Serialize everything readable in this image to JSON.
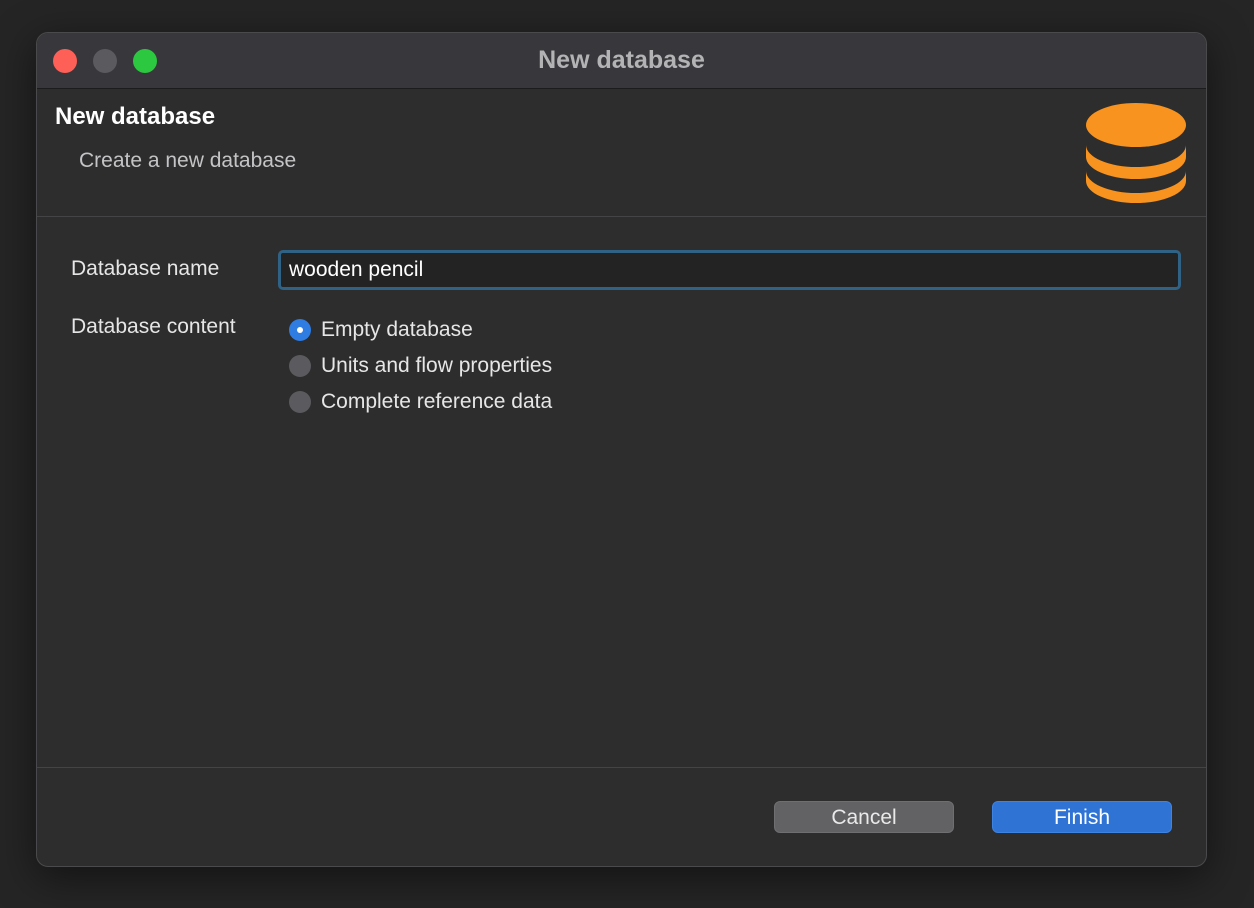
{
  "window": {
    "title": "New database"
  },
  "header": {
    "title": "New database",
    "subtitle": "Create a new database",
    "icon": "database-icon",
    "icon_color": "#f7931e"
  },
  "form": {
    "name_label": "Database name",
    "name_value": "wooden pencil",
    "content_label": "Database content",
    "options": [
      {
        "label": "Empty database",
        "selected": true
      },
      {
        "label": "Units and flow properties",
        "selected": false
      },
      {
        "label": "Complete reference data",
        "selected": false
      }
    ]
  },
  "buttons": {
    "cancel": "Cancel",
    "finish": "Finish"
  },
  "colors": {
    "accent": "#2f73d5",
    "input_focus": "#2f6285",
    "close": "#fe5f57",
    "maximize": "#2bc840"
  }
}
